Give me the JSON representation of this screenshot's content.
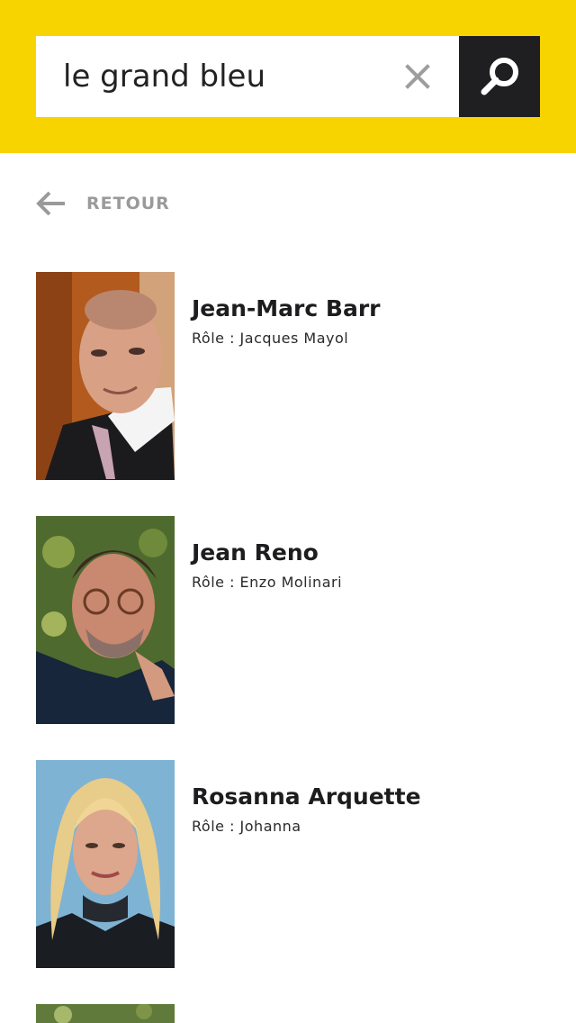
{
  "search": {
    "value": "le grand bleu",
    "clear_icon": "close-icon",
    "search_icon": "magnifier-icon"
  },
  "nav": {
    "back_label": "RETOUR",
    "back_icon": "arrow-left-icon"
  },
  "colors": {
    "header_bg": "#f7d400",
    "search_button_bg": "#1f1f21",
    "muted": "#9a9a9a"
  },
  "actors": [
    {
      "name": "Jean-Marc Barr",
      "role": "Rôle : Jacques Mayol"
    },
    {
      "name": "Jean Reno",
      "role": "Rôle : Enzo Molinari"
    },
    {
      "name": "Rosanna Arquette",
      "role": "Rôle : Johanna"
    }
  ]
}
